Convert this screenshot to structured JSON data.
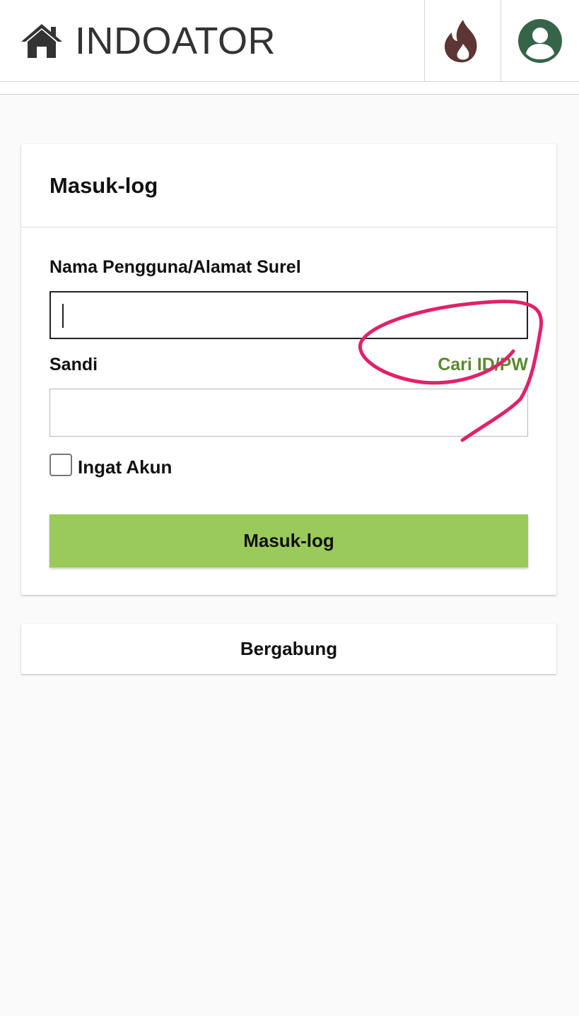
{
  "header": {
    "brand": "INDOATOR",
    "home_icon": "home-icon",
    "fire_icon": "fire-icon",
    "account_icon": "account-icon"
  },
  "login": {
    "title": "Masuk-log",
    "username_label": "Nama Pengguna/Alamat Surel",
    "username_value": "",
    "password_label": "Sandi",
    "password_value": "",
    "forgot_link": "Cari ID/PW",
    "remember_label": "Ingat Akun",
    "remember_checked": false,
    "submit_label": "Masuk-log"
  },
  "join": {
    "label": "Bergabung"
  },
  "colors": {
    "accent_green": "#99ca5b",
    "link_green": "#5b8a2f",
    "fire_brown": "#5d3534",
    "account_green": "#356449",
    "annotation_pink": "#e0226a"
  }
}
